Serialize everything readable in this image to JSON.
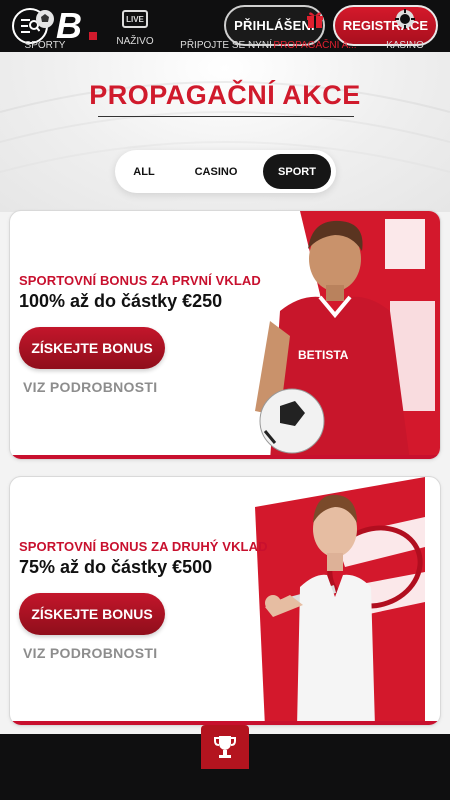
{
  "header": {
    "menu_icon": "menu-search-icon",
    "logo_letter": "B",
    "login_label": "PŘIHLÁŠENÍ",
    "register_label": "REGISTRACE"
  },
  "page": {
    "title": "PROPAGAČNÍ AKCE"
  },
  "filters": {
    "options": [
      "ALL",
      "CASINO",
      "SPORT"
    ],
    "selected": "SPORT"
  },
  "promos": [
    {
      "subtitle": "SPORTOVNÍ BONUS ZA PRVNÍ VKLAD",
      "headline": "100% až do částky €250",
      "cta_label": "ZÍSKEJTE BONUS",
      "details_label": "VIZ PODROBNOSTI",
      "art": "footballer-image",
      "shirt_text": "BETISTA"
    },
    {
      "subtitle": "SPORTOVNÍ BONUS ZA DRUHÝ VKLAD",
      "headline": "75% až do částky €500",
      "cta_label": "ZÍSKEJTE BONUS",
      "details_label": "VIZ PODROBNOSTI",
      "art": "tennis-player-image"
    }
  ],
  "bottom_nav": {
    "items": [
      {
        "label": "SPORTY",
        "icon": "soccer-ball-icon"
      },
      {
        "label": "NAŽIVO",
        "icon": "live-icon",
        "badge": "LIVE"
      },
      {
        "label": "PŘIPOJTE SE NYNÍ",
        "icon": "trophy-icon"
      },
      {
        "label": "PROPAGAČNÍ A...",
        "icon": "gift-icon",
        "active": true
      },
      {
        "label": "KASINO",
        "icon": "casino-chip-icon"
      }
    ]
  },
  "colors": {
    "brand_red": "#d01a2c",
    "header_bg": "#0f0f10",
    "active_pill": "#161616"
  }
}
